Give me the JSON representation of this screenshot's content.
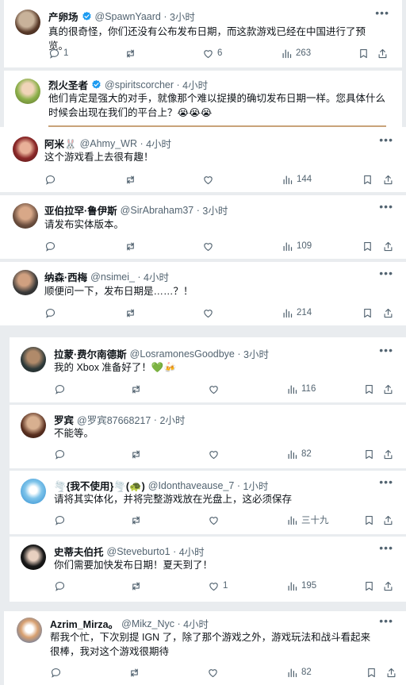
{
  "tweets": [
    {
      "name": "产卵场",
      "handle": "@SpawnYaard",
      "time": "3小时",
      "text": "真的很奇怪，你们还没有公布发布日期，而这款游戏已经在中国进行了预览。",
      "replies": "1",
      "likes": "6",
      "views": "263"
    },
    {
      "name": "烈火圣者",
      "handle": "@spiritscorcher",
      "time": "4小时",
      "text": "他们肯定是强大的对手，就像那个难以捉摸的确切发布日期一样。您具体什么时候会出现在我们的平台上？😭😭😭"
    },
    {
      "name": "阿米🐰",
      "handle": "@Ahmy_WR",
      "time": "4小时",
      "text": "这个游戏看上去很有趣！",
      "views": "144"
    },
    {
      "name": "亚伯拉罕·鲁伊斯",
      "handle": "@SirAbraham37",
      "time": "3小时",
      "text": "请发布实体版本。",
      "views": "109"
    },
    {
      "name": "纳森·西梅",
      "handle": "@nsimei_",
      "time": "4小时",
      "text": "顺便问一下，发布日期是……？！",
      "views": "214"
    },
    {
      "name": "拉蒙·费尔南德斯",
      "handle": "@LosramonesGoodbye",
      "time": "3小时",
      "text": "我的 Xbox 准备好了！💚🍻",
      "views": "116"
    },
    {
      "name": "罗宾",
      "handle": "@罗宾87668217",
      "time": "2小时",
      "text": "不能等。",
      "views": "82"
    },
    {
      "name": "🌪️{我不使用}🌪️(🐢)",
      "handle": "@Idonthaveause_7",
      "time": "1小时",
      "text": "请将其实体化，并将完整游戏放在光盘上，这必须保存",
      "views": "三十九"
    },
    {
      "name": "史蒂夫伯托",
      "handle": "@Steveburto1",
      "time": "4小时",
      "text": "你们需要加快发布日期！夏天到了！",
      "likes": "1",
      "views": "195"
    },
    {
      "name": "Azrim_Mirza。",
      "handle": "@Mikz_Nyc",
      "time": "4小时",
      "text": "帮我个忙，下次别提 IGN 了，除了那个游戏之外，游戏玩法和战斗看起来很棒，我对这个游戏很期待",
      "views": "82"
    }
  ],
  "icons": {
    "more": "more-icon",
    "reply": "reply-icon",
    "retweet": "retweet-icon",
    "like": "like-icon",
    "views": "views-icon",
    "bookmark": "bookmark-icon",
    "share": "share-icon",
    "verified": "verified-badge-icon"
  },
  "colors": {
    "accent": "#1d9bf0",
    "muted": "#536471"
  }
}
